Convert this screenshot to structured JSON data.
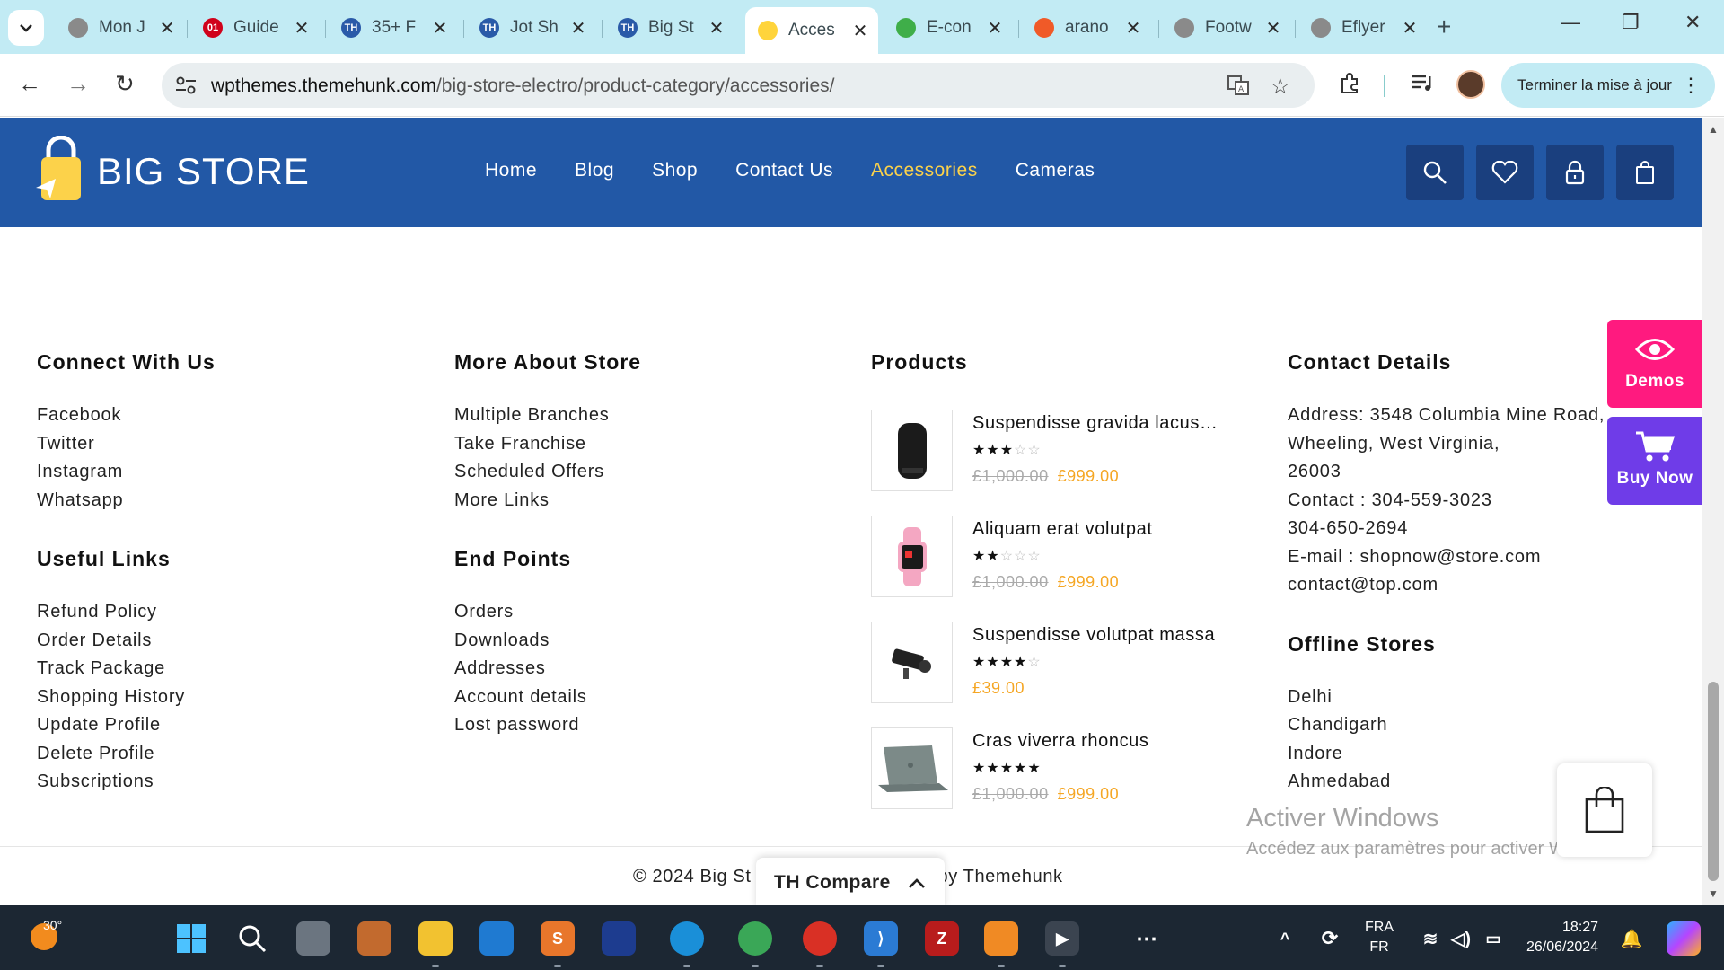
{
  "browser": {
    "tabs": [
      {
        "title": "Mon J",
        "fav_color": "#8a8a8a",
        "fav_text": ""
      },
      {
        "title": "Guide",
        "fav_color": "#d0021b",
        "fav_text": "01"
      },
      {
        "title": "35+ F",
        "fav_color": "#2a5aa8",
        "fav_text": "TH"
      },
      {
        "title": "Jot Sh",
        "fav_color": "#2a5aa8",
        "fav_text": "TH"
      },
      {
        "title": "Big St",
        "fav_color": "#2a5aa8",
        "fav_text": "TH"
      },
      {
        "title": "Acces",
        "fav_color": "#ffd43b",
        "fav_text": ""
      },
      {
        "title": "E-con",
        "fav_color": "#3fae49",
        "fav_text": ""
      },
      {
        "title": "arano",
        "fav_color": "#f05a28",
        "fav_text": ""
      },
      {
        "title": "Footw",
        "fav_color": "#8a8a8a",
        "fav_text": ""
      },
      {
        "title": "Eflyer",
        "fav_color": "#8a8a8a",
        "fav_text": ""
      }
    ],
    "active_tab_index": 5,
    "url_host": "wpthemes.themehunk.com",
    "url_path": "/big-store-electro/product-category/accessories/",
    "update_label": "Terminer la mise à jour"
  },
  "site": {
    "logo_text": "BIG STORE",
    "nav": [
      {
        "label": "Home",
        "current": false
      },
      {
        "label": "Blog",
        "current": false
      },
      {
        "label": "Shop",
        "current": false
      },
      {
        "label": "Contact Us",
        "current": false
      },
      {
        "label": "Accessories",
        "current": true
      },
      {
        "label": "Cameras",
        "current": false
      }
    ],
    "header_icons": [
      "search-icon",
      "heart-icon",
      "lock-icon",
      "shopping-bag-icon"
    ],
    "brand_color": "#2258a6",
    "accent_color": "#fcd24a"
  },
  "footer": {
    "connect": {
      "title": "Connect With Us",
      "links": [
        "Facebook",
        "Twitter",
        "Instagram",
        "Whatsapp"
      ]
    },
    "useful": {
      "title": "Useful Links",
      "links": [
        "Refund Policy",
        "Order Details",
        "Track Package",
        "Shopping History",
        "Update Profile",
        "Delete Profile",
        "Subscriptions"
      ]
    },
    "more": {
      "title": "More About Store",
      "links": [
        "Multiple Branches",
        "Take Franchise",
        "Scheduled Offers",
        "More Links"
      ]
    },
    "endpoints": {
      "title": "End Points",
      "links": [
        "Orders",
        "Downloads",
        "Addresses",
        "Account details",
        "Lost password"
      ]
    },
    "products": {
      "title": "Products",
      "items": [
        {
          "name": "Suspendisse gravida lacus…",
          "rating": 3,
          "old_price": "£1,000.00",
          "price": "£999.00",
          "thumb": "speaker-image"
        },
        {
          "name": "Aliquam erat volutpat",
          "rating": 2,
          "old_price": "£1,000.00",
          "price": "£999.00",
          "thumb": "smartwatch-image"
        },
        {
          "name": "Suspendisse volutpat massa",
          "rating": 4,
          "old_price": "",
          "price": "£39.00",
          "thumb": "security-camera-image"
        },
        {
          "name": "Cras viverra rhoncus",
          "rating": 5,
          "old_price": "£1,000.00",
          "price": "£999.00",
          "thumb": "laptop-image"
        }
      ]
    },
    "contact": {
      "title": "Contact Details",
      "lines": [
        "Address: 3548 Columbia Mine Road,",
        "Wheeling, West Virginia,",
        "26003",
        "Contact : 304-559-3023",
        "304-650-2694",
        "E-mail : shopnow@store.com",
        "contact@top.com"
      ]
    },
    "stores": {
      "title": "Offline Stores",
      "links": [
        "Delhi",
        "Chandigarh",
        "Indore",
        "Ahmedabad"
      ]
    },
    "copyright_left": "© 2024 Big St",
    "copyright_right": "by Themehunk"
  },
  "floating": {
    "demos_label": "Demos",
    "buy_label": "Buy Now",
    "compare_label": "TH Compare"
  },
  "watermark": {
    "line1": "Activer Windows",
    "line2": "Accédez aux paramètres pour activer Windows."
  },
  "taskbar": {
    "temperature": "30°",
    "lang_top": "FRA",
    "lang_bottom": "FR",
    "time": "18:27",
    "date": "26/06/2024"
  }
}
